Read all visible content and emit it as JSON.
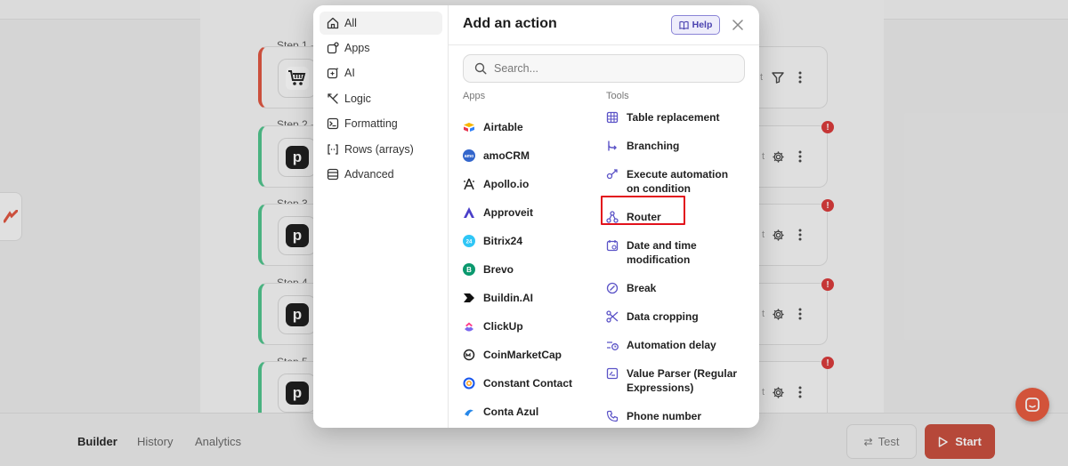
{
  "builder": {
    "steps": [
      {
        "label": "Step 1 -",
        "icon": "cart-icon",
        "status": "error"
      },
      {
        "label": "Step 2 -",
        "icon": "p-app-icon",
        "status": "ok",
        "error_badge": "!"
      },
      {
        "label": "Step 3 -",
        "icon": "p-app-icon",
        "status": "ok",
        "error_badge": "!"
      },
      {
        "label": "Step 4 -",
        "icon": "p-app-icon",
        "status": "ok",
        "error_badge": "!"
      },
      {
        "label": "Step 5 -",
        "icon": "p-app-icon",
        "status": "ok",
        "error_badge": "!"
      }
    ],
    "p_glyph": "p",
    "card_peek": "t"
  },
  "bottom": {
    "tabs": [
      "Builder",
      "History",
      "Analytics"
    ],
    "active_tab": "Builder",
    "test_label": "Test",
    "start_label": "Start"
  },
  "modal": {
    "title": "Add an action",
    "help_label": "Help",
    "search_placeholder": "Search...",
    "categories": [
      {
        "label": "All",
        "icon": "home-icon",
        "active": true
      },
      {
        "label": "Apps",
        "icon": "apps-icon"
      },
      {
        "label": "AI",
        "icon": "ai-sparkle-icon"
      },
      {
        "label": "Logic",
        "icon": "logic-icon"
      },
      {
        "label": "Formatting",
        "icon": "formatting-icon"
      },
      {
        "label": "Rows (arrays)",
        "icon": "array-brackets-icon"
      },
      {
        "label": "Advanced",
        "icon": "advanced-icon"
      }
    ],
    "apps_title": "Apps",
    "tools_title": "Tools",
    "apps": [
      {
        "label": "Airtable",
        "icon": "airtable-icon"
      },
      {
        "label": "amoCRM",
        "icon": "amocrm-icon"
      },
      {
        "label": "Apollo.io",
        "icon": "apollo-icon"
      },
      {
        "label": "Approveit",
        "icon": "approveit-icon"
      },
      {
        "label": "Bitrix24",
        "icon": "bitrix24-icon"
      },
      {
        "label": "Brevo",
        "icon": "brevo-icon"
      },
      {
        "label": "Buildin.AI",
        "icon": "buildin-icon"
      },
      {
        "label": "ClickUp",
        "icon": "clickup-icon"
      },
      {
        "label": "CoinMarketCap",
        "icon": "coinmarketcap-icon"
      },
      {
        "label": "Constant Contact",
        "icon": "constant-contact-icon"
      },
      {
        "label": "Conta Azul",
        "icon": "conta-azul-icon"
      }
    ],
    "tools": [
      {
        "label": "Table replacement",
        "icon": "table-icon"
      },
      {
        "label": "Branching",
        "icon": "branching-icon"
      },
      {
        "label": "Execute automation on condition",
        "icon": "condition-icon"
      },
      {
        "label": "Router",
        "icon": "router-icon",
        "highlighted": true
      },
      {
        "label": "Date and time modification",
        "icon": "calendar-icon"
      },
      {
        "label": "Break",
        "icon": "break-icon"
      },
      {
        "label": "Data cropping",
        "icon": "scissors-icon"
      },
      {
        "label": "Automation delay",
        "icon": "delay-icon"
      },
      {
        "label": "Value Parser (Regular Expressions)",
        "icon": "regex-icon"
      },
      {
        "label": "Phone number",
        "icon": "phone-icon"
      }
    ]
  },
  "colors": {
    "accent": "#4b43b0",
    "start": "#c84a3a",
    "error": "#d93636",
    "highlight": "#e2121c",
    "step_error_border": "#e0533d",
    "step_ok_border": "#4cc38a"
  }
}
